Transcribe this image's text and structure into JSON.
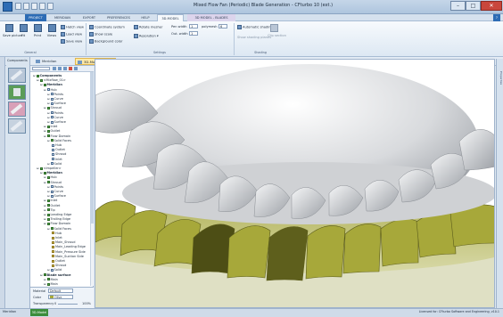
{
  "window": {
    "title": "Mixed Flow Fan (Periodic) Blade Generation - CFturbo 10 (ext.)",
    "minimize": "–",
    "maximize": "□",
    "close": "✕"
  },
  "ribbon_tabs": [
    "PROJECT",
    "MERIDIAN",
    "EXPORT",
    "PREFERENCES",
    "HELP",
    "3D-MODEL",
    "3D MODEL - BLADES"
  ],
  "active_tab_index": 5,
  "ribbon": {
    "btn_save": "Save picture",
    "btn_fit": "Fit",
    "btn_print": "Print",
    "btn_views": "Views",
    "row1_a": "Hatch view",
    "row1_b": "Load view",
    "row1_c": "Save view",
    "row2_a": "Coordinate system",
    "row2_b": "Show scale",
    "row2_c": "Background color",
    "row3_a": "Rotate mesher",
    "row3_b": "Resolution",
    "pen_width_label": "Pen width",
    "pen_width_value": "1",
    "outline_label": "Out. width",
    "outline_value": "1",
    "polymesh_label": "polymesh",
    "polymesh_value": "6",
    "auto_label": "Automatic shading",
    "section_label": "Show shading planes",
    "clip_label": "Clip section",
    "group_general": "General",
    "group_settings": "Settings",
    "group_shading": "Shading"
  },
  "subtabs": [
    "Meridian",
    "3D-Model",
    "Report"
  ],
  "active_subtab_index": 1,
  "left_panel": {
    "label": "Components"
  },
  "tree": [
    {
      "indent": 0,
      "label": "Components",
      "bold": true,
      "box": "g"
    },
    {
      "indent": 1,
      "label": "<Mixflow_01>",
      "bold": false,
      "box": "g"
    },
    {
      "indent": 2,
      "label": "Meridian",
      "bold": true,
      "box": "g"
    },
    {
      "indent": 3,
      "label": "Hub",
      "bold": false,
      "box": "n"
    },
    {
      "indent": 4,
      "label": "Points",
      "bold": false,
      "box": "n"
    },
    {
      "indent": 4,
      "label": "Curve",
      "bold": false,
      "box": "n"
    },
    {
      "indent": 4,
      "label": "Surface",
      "bold": false,
      "box": "n"
    },
    {
      "indent": 3,
      "label": "Shroud",
      "bold": false,
      "box": "g"
    },
    {
      "indent": 4,
      "label": "Points",
      "bold": false,
      "box": "n"
    },
    {
      "indent": 4,
      "label": "Curve",
      "bold": false,
      "box": "n"
    },
    {
      "indent": 4,
      "label": "Surface",
      "bold": false,
      "box": "n"
    },
    {
      "indent": 3,
      "label": "Inlet",
      "bold": false,
      "box": "g"
    },
    {
      "indent": 3,
      "label": "Outlet",
      "bold": false,
      "box": "g"
    },
    {
      "indent": 3,
      "label": "Flow Domain",
      "bold": false,
      "box": "g"
    },
    {
      "indent": 4,
      "label": "Solid Faces",
      "bold": false,
      "box": "g"
    },
    {
      "indent": 5,
      "label": "Hub",
      "bold": false,
      "box": "n"
    },
    {
      "indent": 5,
      "label": "Outlet",
      "bold": false,
      "box": "n"
    },
    {
      "indent": 5,
      "label": "Shroud",
      "bold": false,
      "box": "n"
    },
    {
      "indent": 5,
      "label": "Inlet",
      "bold": false,
      "box": "n"
    },
    {
      "indent": 4,
      "label": "Solid",
      "bold": false,
      "box": "n"
    },
    {
      "indent": 1,
      "label": "<Impeller>",
      "bold": false,
      "box": "g"
    },
    {
      "indent": 2,
      "label": "Meridian",
      "bold": true,
      "box": "g"
    },
    {
      "indent": 3,
      "label": "Hub",
      "bold": false,
      "box": "g"
    },
    {
      "indent": 3,
      "label": "Shroud",
      "bold": false,
      "box": "g"
    },
    {
      "indent": 4,
      "label": "Points",
      "bold": false,
      "box": "n"
    },
    {
      "indent": 4,
      "label": "Curve",
      "bold": false,
      "box": "n"
    },
    {
      "indent": 4,
      "label": "Surface",
      "bold": false,
      "box": "n"
    },
    {
      "indent": 3,
      "label": "Inlet",
      "bold": false,
      "box": "g"
    },
    {
      "indent": 3,
      "label": "Outlet",
      "bold": false,
      "box": "g"
    },
    {
      "indent": 3,
      "label": "Tip",
      "bold": false,
      "box": "g"
    },
    {
      "indent": 3,
      "label": "Leading Edge",
      "bold": false,
      "box": "g"
    },
    {
      "indent": 3,
      "label": "Trailing Edge",
      "bold": false,
      "box": "g"
    },
    {
      "indent": 3,
      "label": "Flow Domain",
      "bold": false,
      "box": "g"
    },
    {
      "indent": 4,
      "label": "Solid Faces",
      "bold": false,
      "box": "g"
    },
    {
      "indent": 5,
      "label": "Hub",
      "bold": false,
      "box": "o"
    },
    {
      "indent": 5,
      "label": "Inlet",
      "bold": false,
      "box": "o"
    },
    {
      "indent": 5,
      "label": "Main_Shroud",
      "bold": false,
      "box": "o"
    },
    {
      "indent": 5,
      "label": "Main_Leading Edge",
      "bold": false,
      "box": "o"
    },
    {
      "indent": 5,
      "label": "Main_Pressure Side",
      "bold": false,
      "box": "o"
    },
    {
      "indent": 5,
      "label": "Main_Suction Side",
      "bold": false,
      "box": "o"
    },
    {
      "indent": 5,
      "label": "Outlet",
      "bold": false,
      "box": "o"
    },
    {
      "indent": 5,
      "label": "Shroud",
      "bold": false,
      "box": "o"
    },
    {
      "indent": 4,
      "label": "Solid",
      "bold": false,
      "box": "n"
    },
    {
      "indent": 2,
      "label": "Blade surface",
      "bold": true,
      "box": "g"
    },
    {
      "indent": 3,
      "label": "Main",
      "bold": false,
      "box": "g"
    },
    {
      "indent": 3,
      "label": "Main",
      "bold": false,
      "box": "g"
    },
    {
      "indent": 4,
      "label": "Blade Solid",
      "bold": false,
      "box": "o"
    }
  ],
  "props": {
    "material_label": "Material",
    "material_value": "Default",
    "color_label": "Color",
    "color_value": "Olive",
    "transparency_label": "Transparency",
    "transparency_value": "0",
    "transparency_max": "100%"
  },
  "right_strip": "Properties",
  "status": {
    "left": "Meridian",
    "tab": "3D-Model",
    "right": "Licensed for: CFturbo Software and Engineering, v10.1"
  },
  "colors": {
    "olive_blade": "#a7a83a",
    "olive_dark": "#4d4e15",
    "grey_blade": "#d4d6d9",
    "accent_green": "#3b8d3b"
  }
}
